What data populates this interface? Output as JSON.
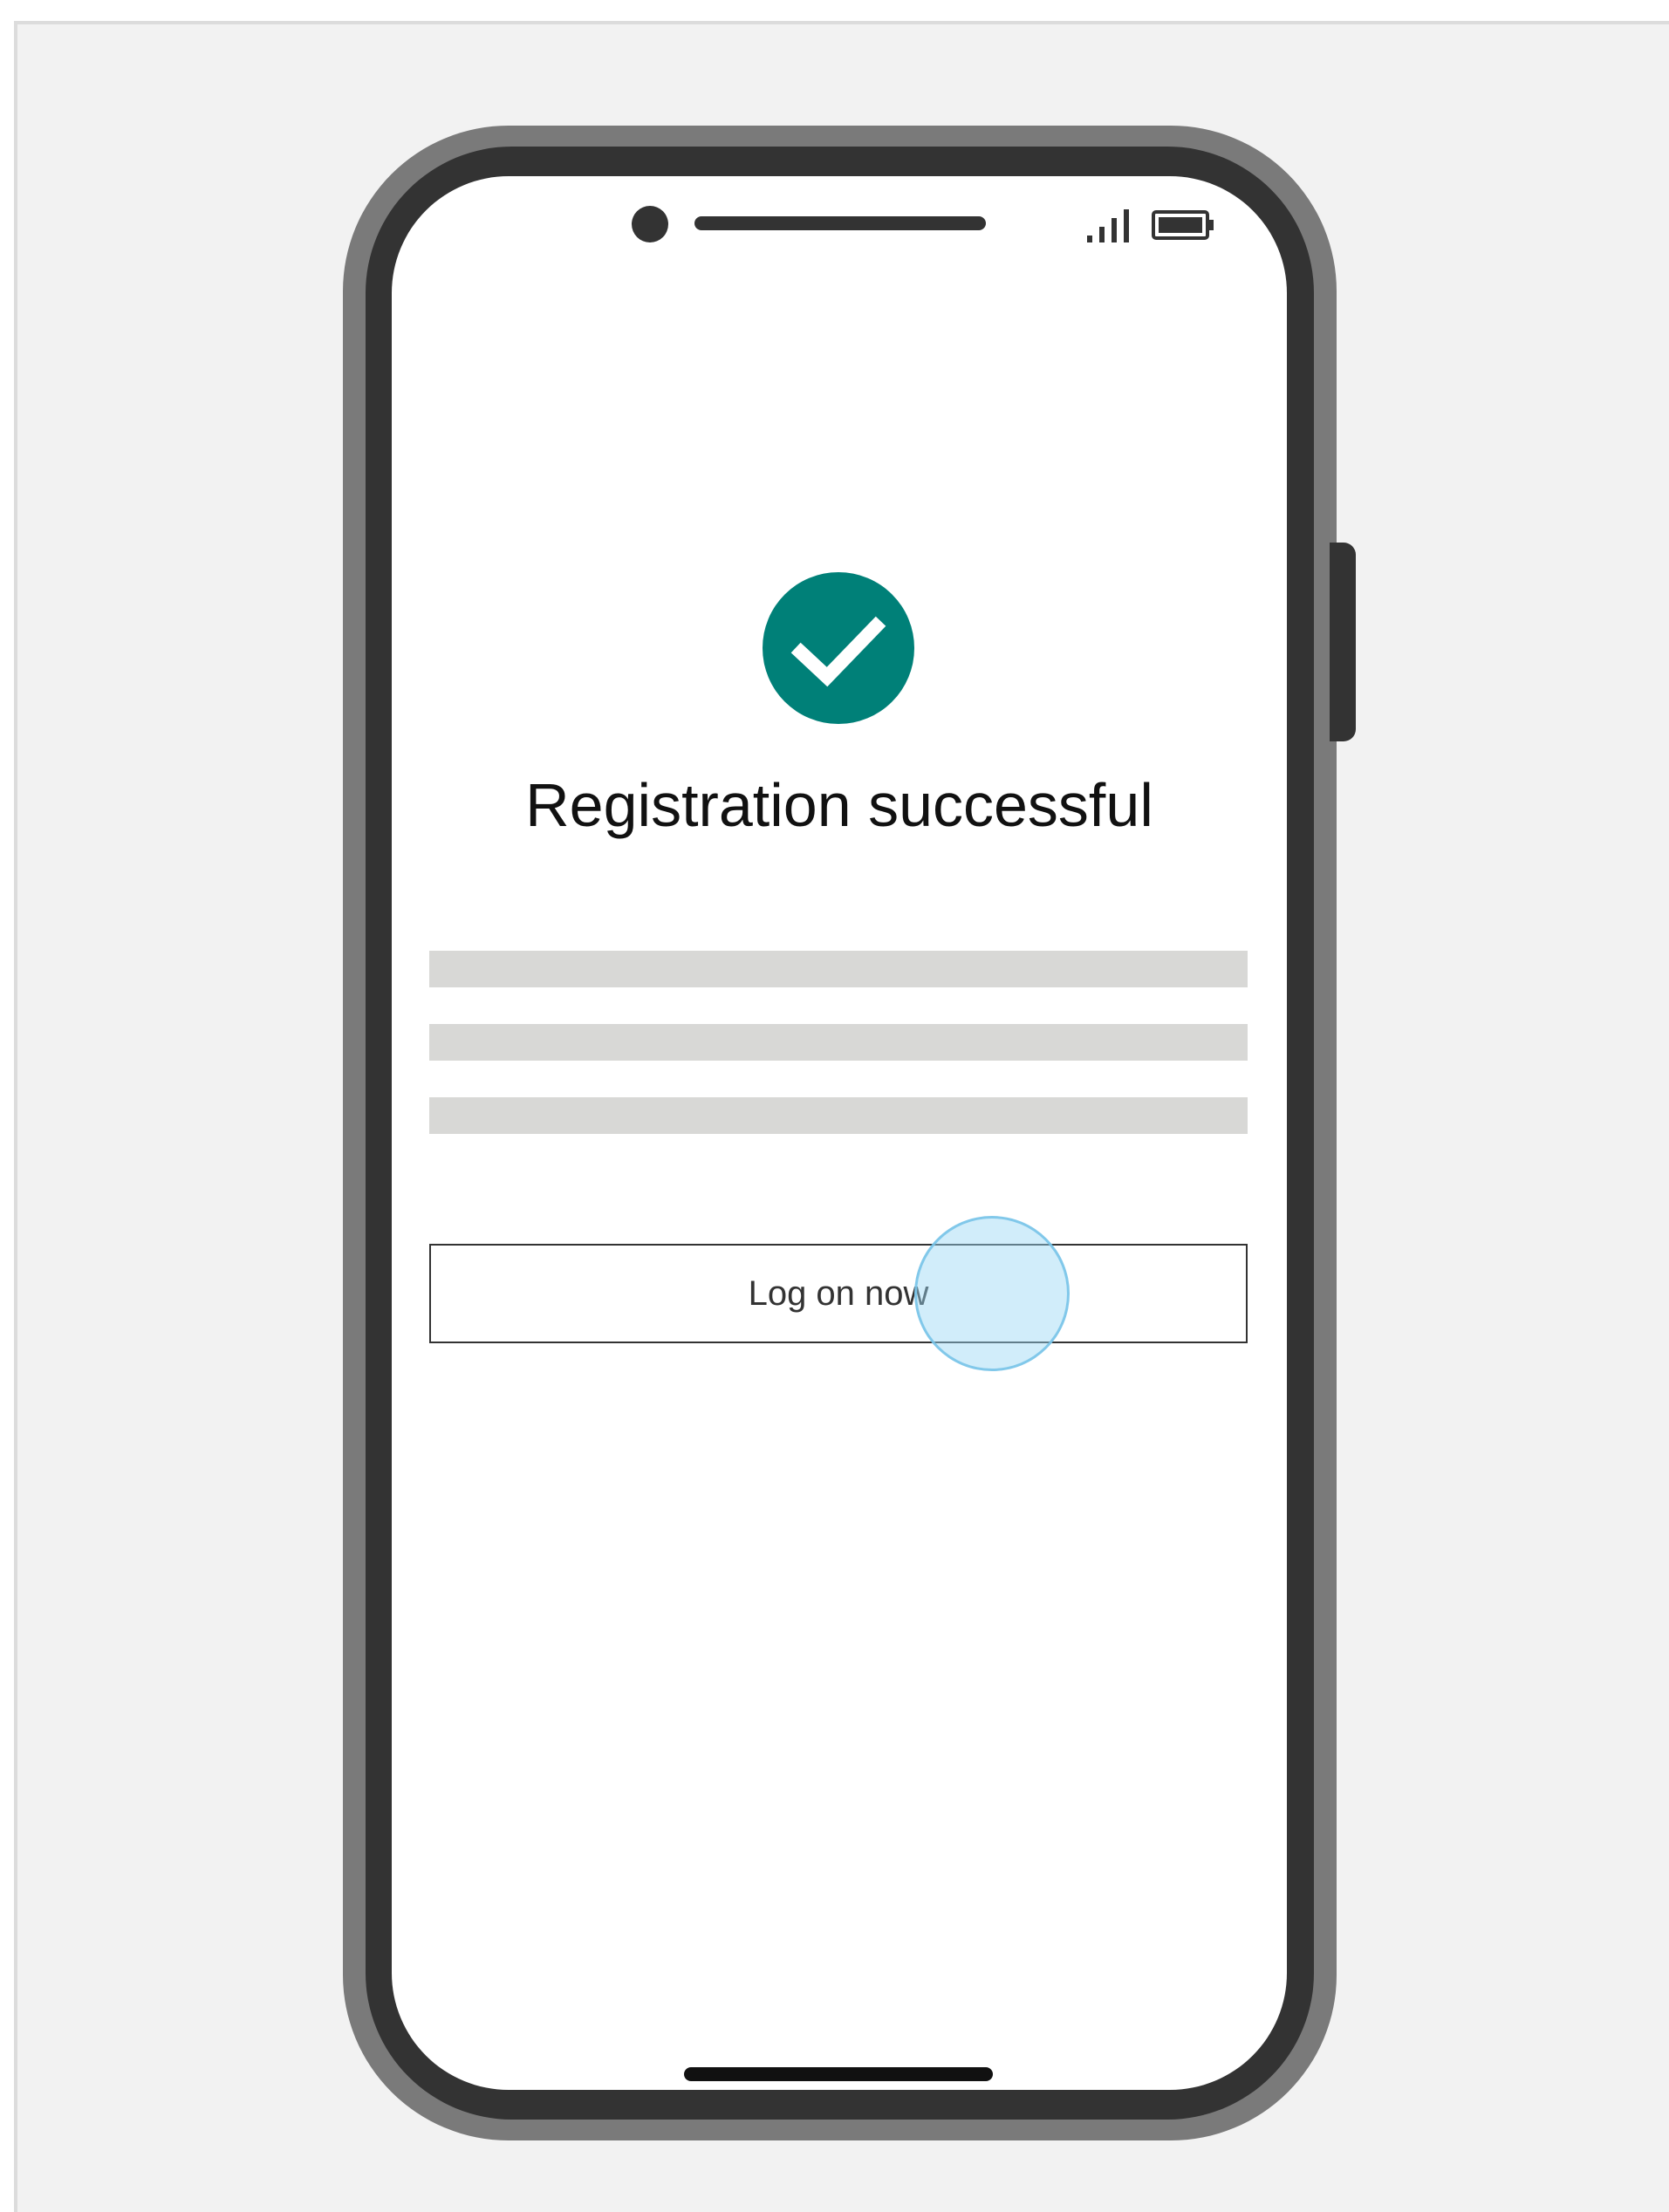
{
  "screen": {
    "title": "Registration successful",
    "primary_action": "Log on now"
  },
  "status_bar": {
    "signal_icon": "signal-bars-icon",
    "battery_icon": "battery-icon"
  },
  "colors": {
    "accent": "#008078",
    "tap_highlight": "#98d6f3",
    "device_frame": "#333333",
    "placeholder": "#d8d8d6"
  }
}
